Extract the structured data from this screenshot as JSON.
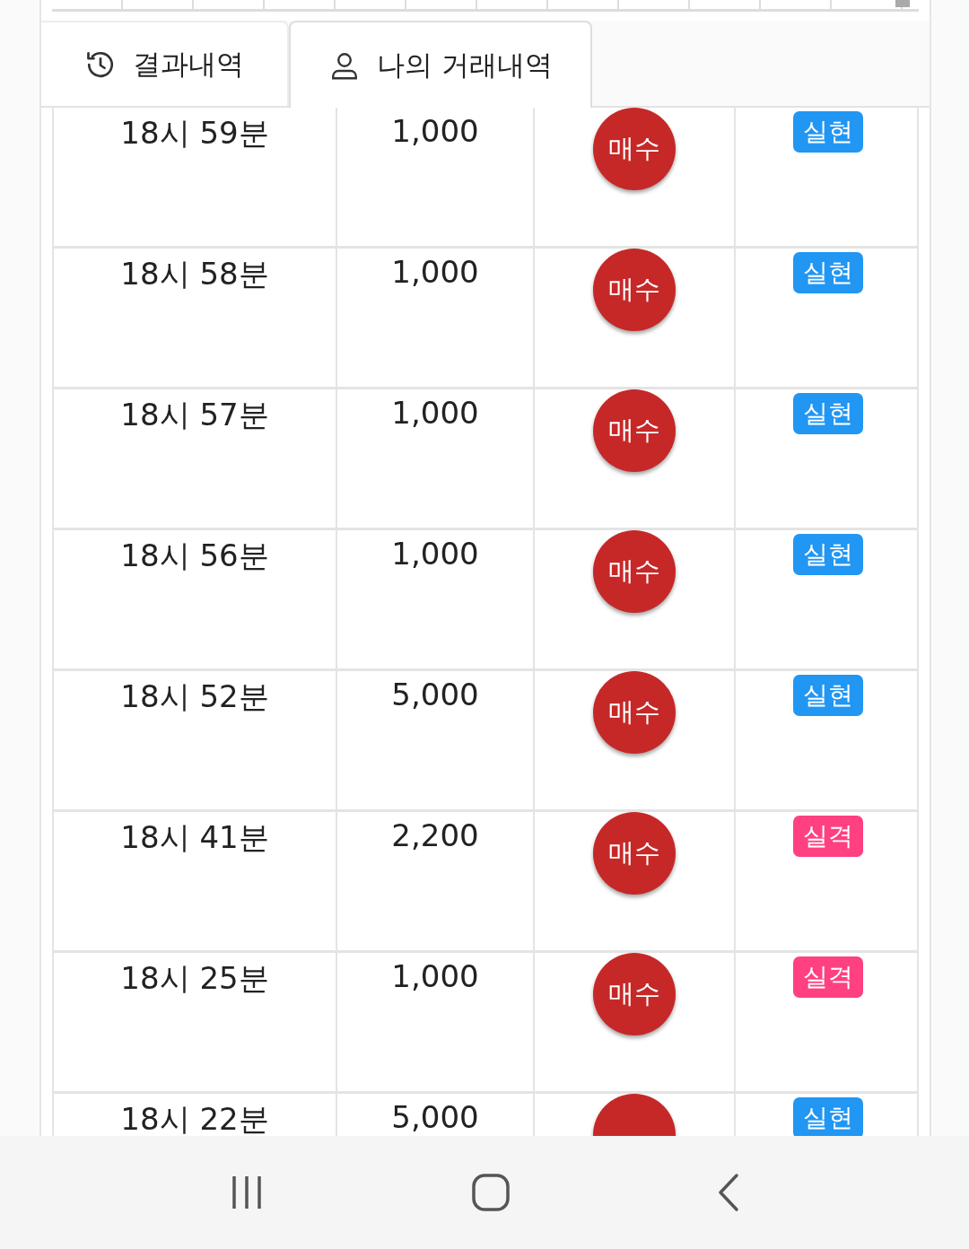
{
  "tabs": [
    {
      "label": "결과내역",
      "selected": false
    },
    {
      "label": "나의 거래내역",
      "selected": true
    }
  ],
  "rows": [
    {
      "time": "18시 59분",
      "amount": "1,000",
      "action": "매수",
      "result": "실현",
      "color": "#2196f3"
    },
    {
      "time": "18시 58분",
      "amount": "1,000",
      "action": "매수",
      "result": "실현",
      "color": "#2196f3"
    },
    {
      "time": "18시 57분",
      "amount": "1,000",
      "action": "매수",
      "result": "실현",
      "color": "#2196f3"
    },
    {
      "time": "18시 56분",
      "amount": "1,000",
      "action": "매수",
      "result": "실현",
      "color": "#2196f3"
    },
    {
      "time": "18시 52분",
      "amount": "5,000",
      "action": "매수",
      "result": "실현",
      "color": "#2196f3"
    },
    {
      "time": "18시 41분",
      "amount": "2,200",
      "action": "매수",
      "result": "실격",
      "color": "#ff4081"
    },
    {
      "time": "18시 25분",
      "amount": "1,000",
      "action": "매수",
      "result": "실격",
      "color": "#ff4081"
    },
    {
      "time": "18시 22분",
      "amount": "5,000",
      "result": "실현",
      "color": "#2196f3"
    }
  ]
}
